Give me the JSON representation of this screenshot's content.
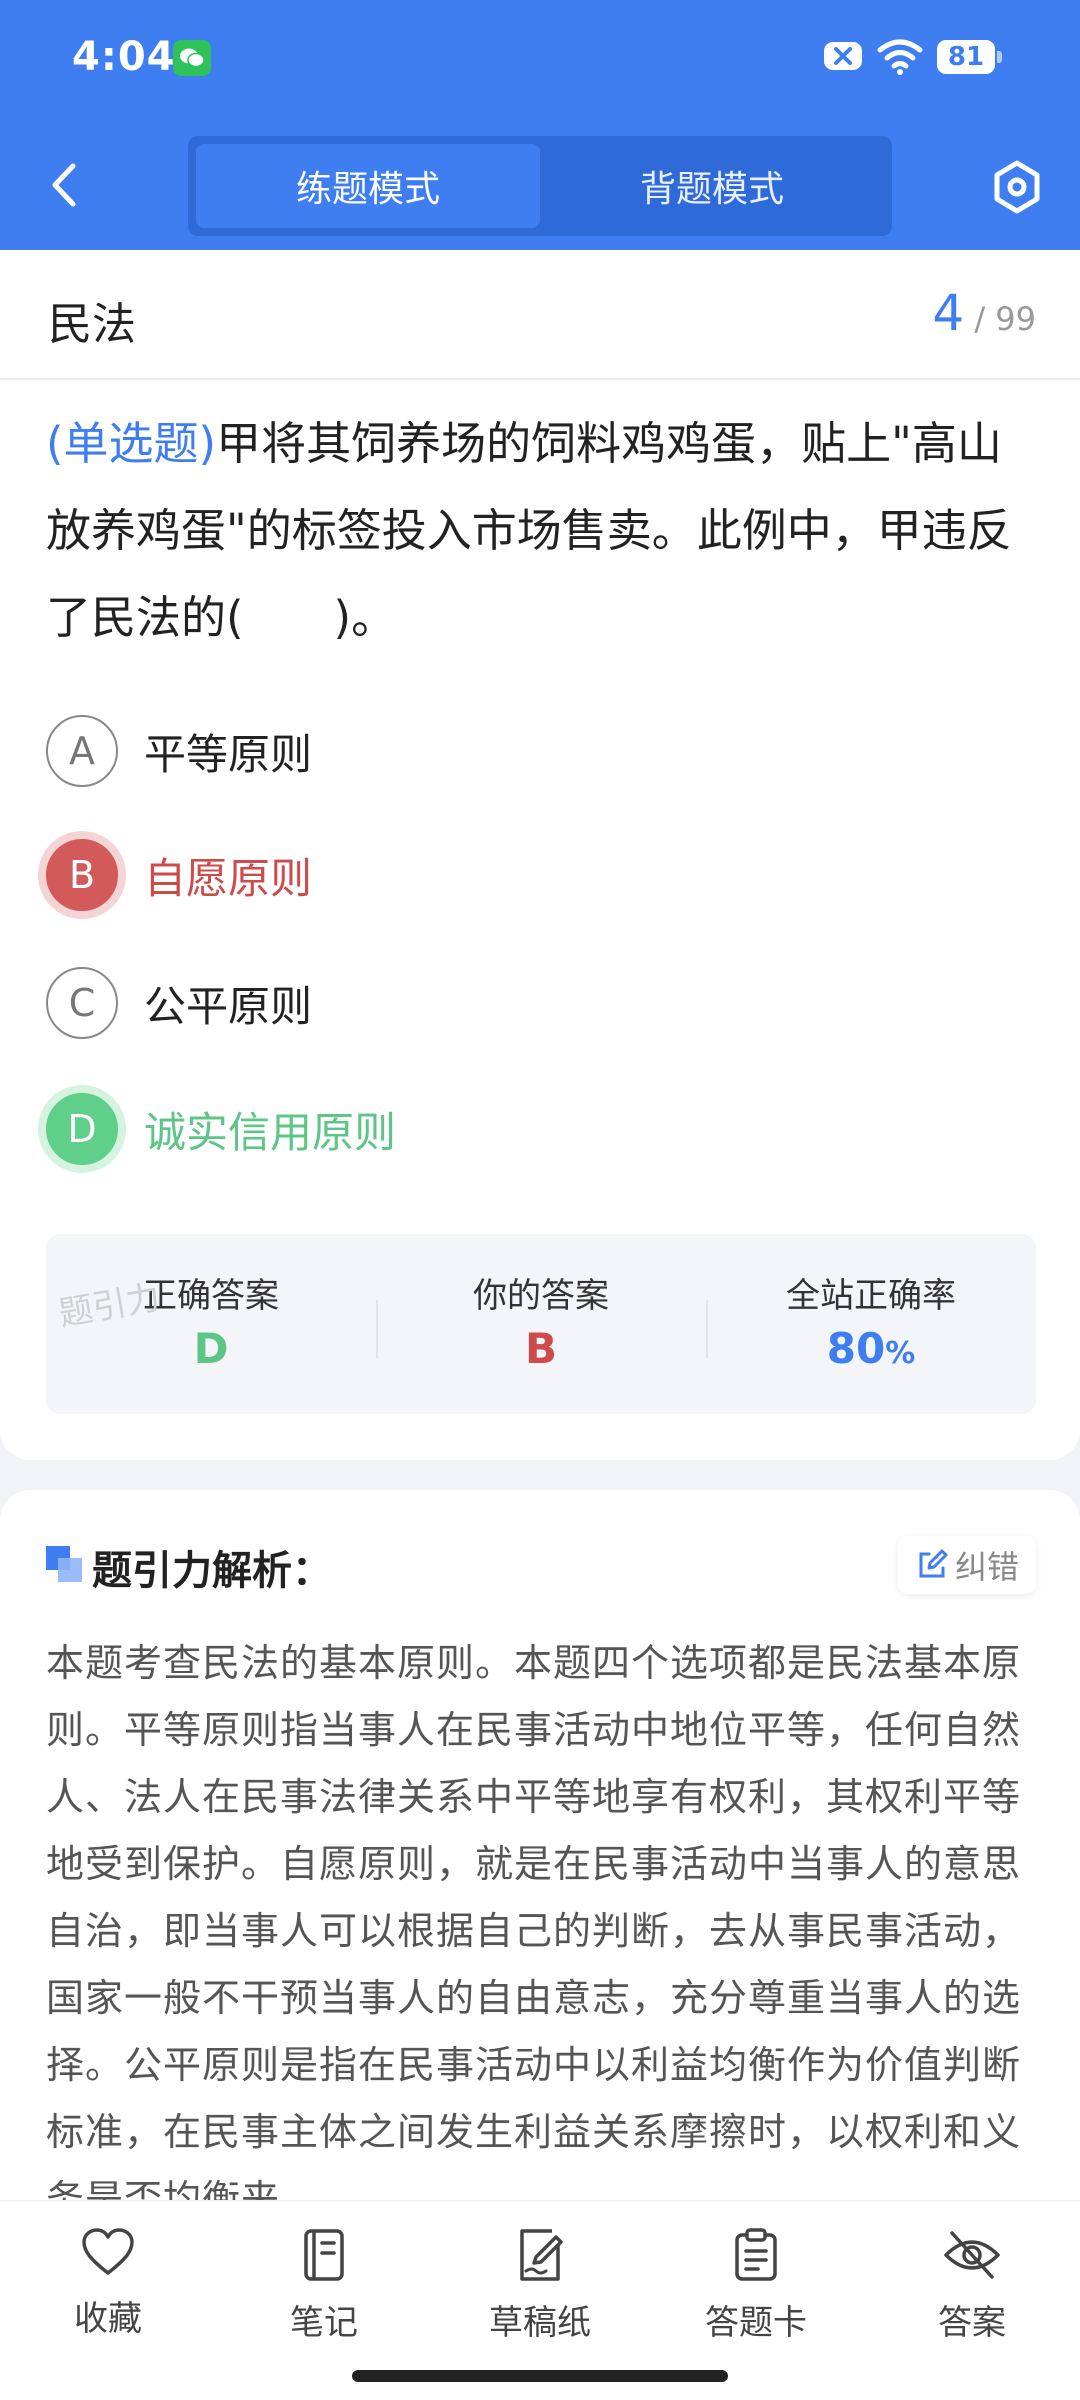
{
  "status": {
    "time": "4:04",
    "battery": "81"
  },
  "header": {
    "tabs": [
      {
        "label": "练题模式",
        "active": true
      },
      {
        "label": "背题模式",
        "active": false
      }
    ]
  },
  "question_meta": {
    "subject": "民法",
    "current": "4",
    "total": "/ 99"
  },
  "question": {
    "type": "(单选题)",
    "text": "甲将其饲养场的饲料鸡鸡蛋，贴上\"高山放养鸡蛋\"的标签投入市场售卖。此例中，甲违反了民法的(　　)。",
    "options": [
      {
        "letter": "A",
        "text": "平等原则",
        "state": "normal"
      },
      {
        "letter": "B",
        "text": "自愿原则",
        "state": "wrong"
      },
      {
        "letter": "C",
        "text": "公平原则",
        "state": "normal"
      },
      {
        "letter": "D",
        "text": "诚实信用原则",
        "state": "right"
      }
    ]
  },
  "stats": {
    "correct_label": "正确答案",
    "correct_value": "D",
    "yours_label": "你的答案",
    "yours_value": "B",
    "rate_label": "全站正确率",
    "rate_value": "80",
    "rate_unit": "%",
    "watermark": "题引力"
  },
  "analysis": {
    "title": "题引力解析：",
    "fix_label": "纠错",
    "text": "本题考查民法的基本原则。本题四个选项都是民法基本原则。平等原则指当事人在民事活动中地位平等，任何自然人、法人在民事法律关系中平等地享有权利，其权利平等地受到保护。自愿原则，就是在民事活动中当事人的意思自治，即当事人可以根据自己的判断，去从事民事活动，国家一般不干预当事人的自由意志，充分尊重当事人的选择。公平原则是指在民事活动中以利益均衡作为价值判断标准，在民事主体之间发生利益关系摩擦时，以权利和义务是否均衡来"
  },
  "bottom_nav": [
    {
      "label": "收藏",
      "icon": "heart-icon"
    },
    {
      "label": "笔记",
      "icon": "notebook-icon"
    },
    {
      "label": "草稿纸",
      "icon": "draft-paper-icon"
    },
    {
      "label": "答题卡",
      "icon": "answer-card-icon"
    },
    {
      "label": "答案",
      "icon": "eye-off-icon"
    }
  ],
  "colors": {
    "primary": "#3f7ef0",
    "wrong": "#cf4b4b",
    "right": "#5dc586"
  }
}
